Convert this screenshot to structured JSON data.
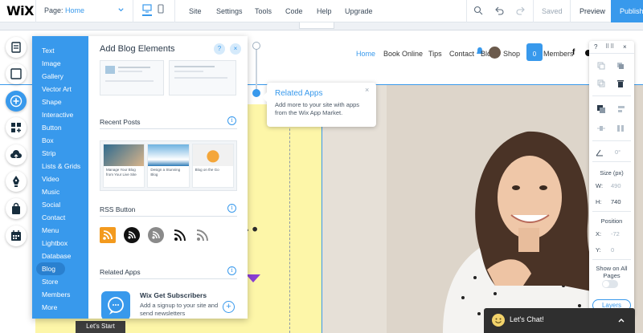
{
  "topbar": {
    "logo": "WiX",
    "page_label": "Page:",
    "page_value": "Home",
    "menu": [
      "Site",
      "Settings",
      "Tools",
      "Code",
      "Help",
      "Upgrade"
    ],
    "saved": "Saved",
    "preview": "Preview",
    "publish": "Publish"
  },
  "site": {
    "nav": [
      "Home",
      "Book Online",
      "Tips",
      "Contact",
      "Blog",
      "Shop",
      "Members"
    ],
    "social": [
      "f"
    ],
    "cart_count": "0",
    "big_letter": "l.",
    "lets_start": "Let's Start"
  },
  "rail": {
    "icons": [
      "pages-icon",
      "background-icon",
      "add-icon",
      "apps-icon",
      "upload-icon",
      "blog-pen-icon",
      "store-bag-icon",
      "bookings-calendar-icon"
    ]
  },
  "add_panel": {
    "categories": [
      "Text",
      "Image",
      "Gallery",
      "Vector Art",
      "Shape",
      "Interactive",
      "Button",
      "Box",
      "Strip",
      "Lists & Grids",
      "Video",
      "Music",
      "Social",
      "Contact",
      "Menu",
      "Lightbox",
      "Database",
      "Blog",
      "Store",
      "Members",
      "More"
    ],
    "active_category": "Blog",
    "title": "Add Blog Elements",
    "help": "?",
    "close": "×",
    "sections": {
      "recent_posts": "Recent Posts",
      "rss_button": "RSS Button",
      "related_apps": "Related Apps"
    },
    "posts": [
      {
        "title": "Manage Your Blog from Your Live Site"
      },
      {
        "title": "Design a Stunning Blog"
      },
      {
        "title": "Blog on the Go"
      }
    ],
    "app": {
      "name": "Wix Get Subscribers",
      "description": "Add a signup to your site and send newsletters",
      "add": "+"
    }
  },
  "tooltip": {
    "title": "Related Apps",
    "text": "Add more to your site with apps from the Wix App Market.",
    "close": "×"
  },
  "inspector": {
    "help": "?",
    "close": "×",
    "rotation": "0°",
    "size_label": "Size (px)",
    "w_key": "W:",
    "w_val": "490",
    "h_key": "H:",
    "h_val": "740",
    "position_label": "Position",
    "x_key": "X:",
    "x_val": "-72",
    "y_key": "Y:",
    "y_val": "0",
    "show_all_label": "Show on All Pages",
    "layers": "Layers"
  },
  "chat": {
    "label": "Let's Chat!"
  },
  "colors": {
    "accent": "#3899ec",
    "yellow_bg": "#fdf6a8",
    "chat_bg": "#2f2f2f"
  }
}
